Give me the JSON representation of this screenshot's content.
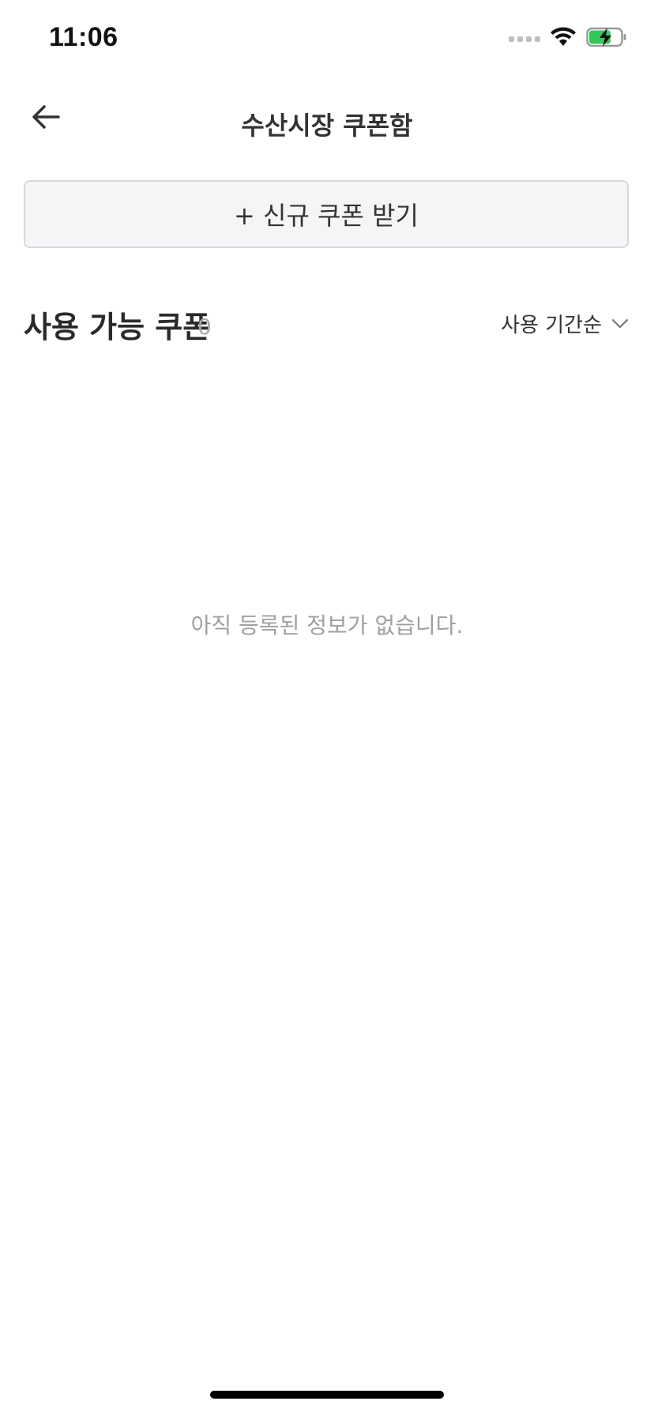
{
  "status_bar": {
    "time": "11:06",
    "icons": [
      "cellular-signal-icon",
      "wifi-icon",
      "battery-charging-icon"
    ]
  },
  "header": {
    "back_icon": "back-arrow-icon",
    "title": "수산시장 쿠폰함"
  },
  "actions": {
    "new_coupon_label": "+ 신규 쿠폰 받기"
  },
  "coupon_list": {
    "title": "사용 가능 쿠폰",
    "count": "0",
    "sort_label": "사용 기간순",
    "sort_icon": "chevron-down-icon",
    "empty_text": "아직 등록된 정보가 없습니다."
  },
  "colors": {
    "accent_green": "#34c759",
    "border": "#d6d8dc",
    "button_bg": "#f4f5f7",
    "muted_text": "#a0a0a0"
  }
}
